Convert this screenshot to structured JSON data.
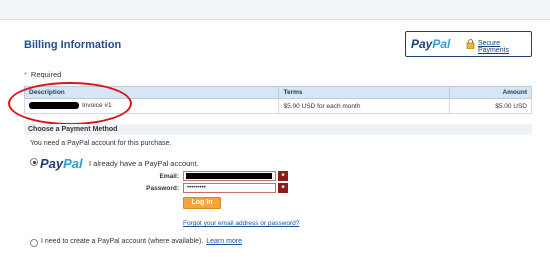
{
  "header": {
    "title": "Billing Information",
    "logo_pay": "Pay",
    "logo_pal": "Pal",
    "secure_payments": "Secure Payments"
  },
  "required": {
    "star": "*",
    "label": "Required"
  },
  "table": {
    "headers": [
      "Description",
      "Terms",
      "Amount"
    ],
    "rows": [
      {
        "description": "Invoice #1",
        "terms": "$5.00 USD for each month",
        "amount": "$5.00 USD"
      }
    ]
  },
  "payment": {
    "section_title": "Choose a Payment Method",
    "need_text": "You need a PayPal account for this purchase.",
    "logo_pay": "Pay",
    "logo_pal": "Pal",
    "already_text": "I already have a PayPal account.",
    "email_label": "Email:",
    "password_label": "Password:",
    "password_value": "•••••••••",
    "required_mark": "*",
    "login_label": "Log In",
    "forgot_text": "Forgot your email address or password?",
    "create_text": "I need to create a PayPal account (where available).",
    "learn_more": "Learn more"
  },
  "colors": {
    "title_blue": "#1f4f8c",
    "annotation_red": "#d81818",
    "login_orange": "#f7a43a"
  }
}
